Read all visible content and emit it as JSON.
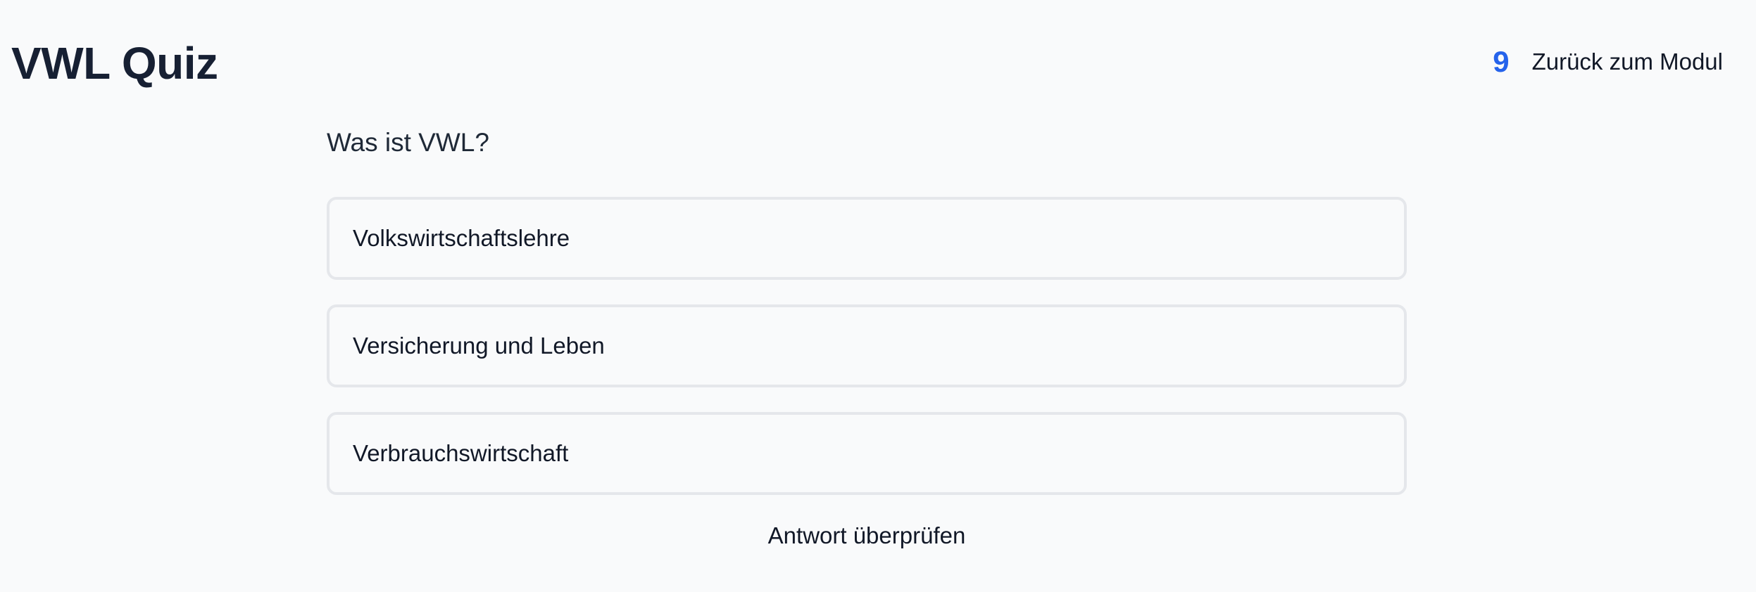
{
  "header": {
    "title": "VWL Quiz",
    "score": "9",
    "back_label": "Zurück zum Modul"
  },
  "quiz": {
    "question": "Was ist VWL?",
    "options": [
      {
        "label": "Volkswirtschaftslehre"
      },
      {
        "label": "Versicherung und Leben"
      },
      {
        "label": "Verbrauchswirtschaft"
      }
    ],
    "check_label": "Antwort überprüfen"
  },
  "colors": {
    "background": "#f9fafb",
    "accent": "#2563eb",
    "title": "#172033",
    "option_border": "#e5e7eb"
  }
}
